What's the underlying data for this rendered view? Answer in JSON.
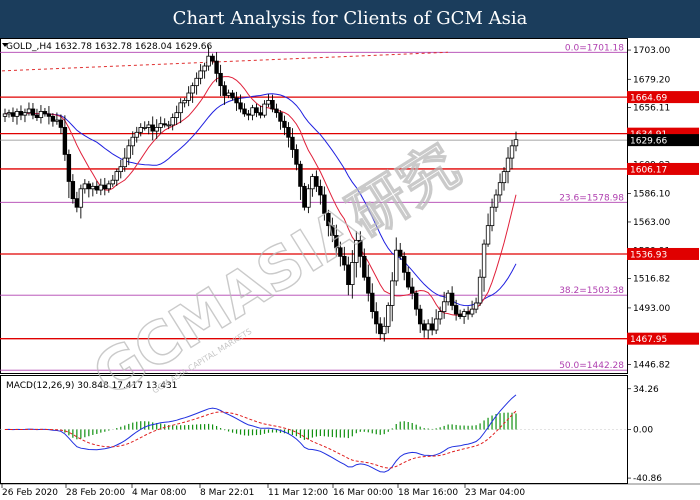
{
  "banner": {
    "title": "Chart Analysis for Clients of GCM Asia",
    "background": "#1b3d5c"
  },
  "chart_data": [
    {
      "type": "candlestick",
      "symbol_header": "GOLD_,H4  1632.78 1632.78 1628.04 1629.66",
      "ylim": [
        1440,
        1712
      ],
      "yticks": [
        "1703.00",
        "1679.20",
        "1656.11",
        "1633.02",
        "1609.93",
        "1586.10",
        "1563.00",
        "1539.91",
        "1516.82",
        "1493.00",
        "1469.91",
        "1446.82"
      ],
      "xticks": [
        "26 Feb 2020",
        "28 Feb 20:00",
        "4 Mar 08:00",
        "8 Mar 22:01",
        "11 Mar 12:00",
        "16 Mar 00:00",
        "18 Mar 16:00",
        "23 Mar 04:00"
      ],
      "current_price": "1629.66",
      "horizontal_levels": [
        {
          "label": "0.0=1701.18",
          "value": 1701.18,
          "kind": "fibo",
          "color": "#b040b0"
        },
        {
          "label": "1664.69",
          "value": 1664.69,
          "kind": "sr",
          "color": "#e00000"
        },
        {
          "label": "1634.91",
          "value": 1634.91,
          "kind": "sr",
          "color": "#e00000"
        },
        {
          "label": "1606.17",
          "value": 1606.17,
          "kind": "sr",
          "color": "#e00000"
        },
        {
          "label": "23.6=1578.98",
          "value": 1578.98,
          "kind": "fibo",
          "color": "#b040b0"
        },
        {
          "label": "1536.93",
          "value": 1536.93,
          "kind": "sr",
          "color": "#e00000"
        },
        {
          "label": "38.2=1503.38",
          "value": 1503.38,
          "kind": "fibo",
          "color": "#b040b0"
        },
        {
          "label": "1467.95",
          "value": 1467.95,
          "kind": "sr",
          "color": "#e00000"
        },
        {
          "label": "50.0=1442.28",
          "value": 1442.28,
          "kind": "fibo",
          "color": "#b040b0"
        }
      ],
      "close_series": [
        1651,
        1652,
        1649,
        1653,
        1650,
        1652,
        1655,
        1650,
        1648,
        1653,
        1651,
        1649,
        1645,
        1646,
        1640,
        1618,
        1596,
        1582,
        1575,
        1590,
        1594,
        1590,
        1592,
        1589,
        1593,
        1590,
        1594,
        1597,
        1604,
        1608,
        1615,
        1625,
        1632,
        1636,
        1640,
        1640,
        1642,
        1637,
        1640,
        1643,
        1642,
        1642,
        1648,
        1652,
        1660,
        1662,
        1668,
        1674,
        1680,
        1686,
        1690,
        1698,
        1694,
        1684,
        1674,
        1666,
        1668,
        1664,
        1660,
        1655,
        1651,
        1650,
        1656,
        1652,
        1650,
        1659,
        1662,
        1655,
        1652,
        1645,
        1640,
        1632,
        1622,
        1610,
        1592,
        1575,
        1590,
        1600,
        1592,
        1585,
        1570,
        1560,
        1552,
        1542,
        1535,
        1528,
        1512,
        1530,
        1548,
        1535,
        1518,
        1505,
        1490,
        1480,
        1472,
        1478,
        1495,
        1515,
        1540,
        1535,
        1522,
        1510,
        1505,
        1492,
        1480,
        1475,
        1480,
        1475,
        1484,
        1490,
        1498,
        1505,
        1495,
        1488,
        1486,
        1490,
        1488,
        1492,
        1497,
        1518,
        1545,
        1560,
        1575,
        1585,
        1595,
        1604,
        1615,
        1625,
        1630
      ],
      "candle_width": 3.6,
      "up_color": "#000000",
      "down_color": "#000000",
      "ma_fast_color": "#e0203a",
      "ma_slow_color": "#2020e0",
      "trendline_color": "#e03030"
    },
    {
      "type": "macd",
      "label": "MACD(12,26,9) 30.848 17.417 13.431",
      "ylim": [
        -45,
        45
      ],
      "yticks": [
        "34.26",
        "0.00",
        "-40.86"
      ],
      "signal_color": "#e02020",
      "macd_color": "#2030e0",
      "hist_color": "#109010"
    }
  ],
  "watermark": {
    "main": "GCMASIA研究",
    "sub": "GCM ASIA CAPITAL MARKETS",
    "color": "#b9b9b9"
  }
}
